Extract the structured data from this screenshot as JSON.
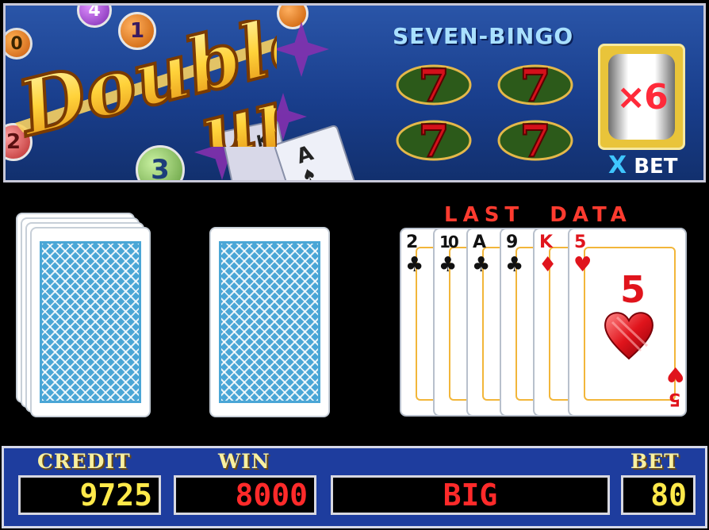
{
  "banner": {
    "title_line1": "Double",
    "title_line2": "up",
    "bonus_title": "SEVEN-BINGO",
    "multiplier": "×6",
    "multiplier_caption_x": "X",
    "multiplier_caption_bet": "BET",
    "ball_numbers": [
      "0",
      "4",
      "1",
      "2",
      "3"
    ],
    "seven_symbol": "7",
    "card_ranks": [
      "K",
      "A"
    ]
  },
  "table": {
    "last_data_label": "LAST  DATA",
    "history": [
      {
        "rank": "2",
        "suit": "♣",
        "color": "#111111"
      },
      {
        "rank": "10",
        "suit": "♣",
        "color": "#111111"
      },
      {
        "rank": "A",
        "suit": "♣",
        "color": "#111111"
      },
      {
        "rank": "9",
        "suit": "♣",
        "color": "#111111"
      },
      {
        "rank": "K",
        "suit": "♦",
        "color": "#e0141c"
      },
      {
        "rank": "5",
        "suit": "♥",
        "color": "#e0141c"
      }
    ],
    "featured_card": {
      "rank": "5",
      "suit": "♥"
    }
  },
  "status": {
    "credit_label": "CREDIT",
    "credit_value": "9725",
    "win_label": "WIN",
    "win_value": "8000",
    "choice_value": "BIG",
    "bet_label": "BET",
    "bet_value": "80"
  },
  "colors": {
    "panel_blue": "#1e3d9e",
    "label_yellow": "#f8f0a0",
    "value_yellow": "#ffe94a",
    "value_red": "#ff2a2a",
    "card_back_blue": "#4aa6d6"
  }
}
